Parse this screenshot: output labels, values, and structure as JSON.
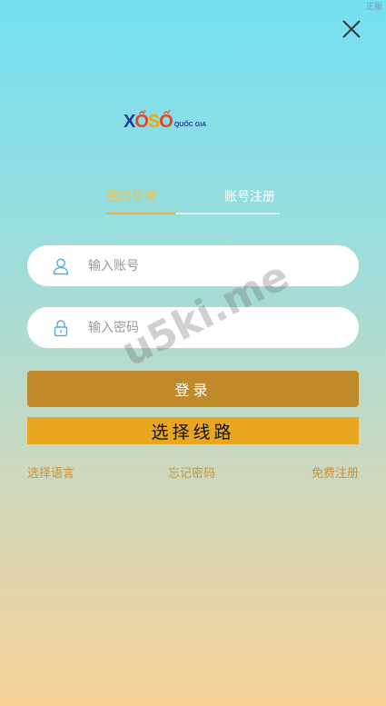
{
  "corner_tag": "正版",
  "logo": {
    "main": [
      "X",
      "Ổ",
      "S",
      "Ố"
    ],
    "sub": "QUỐC GIA"
  },
  "tabs": {
    "login": "密码登录",
    "register": "账号注册"
  },
  "form": {
    "account_placeholder": "输入账号",
    "password_placeholder": "输入密码",
    "account_icon": "user-icon",
    "password_icon": "lock-icon"
  },
  "buttons": {
    "login": "登录",
    "select_line": "选择线路"
  },
  "links": {
    "language": "选择语言",
    "forgot": "忘记密码",
    "free_register": "免费注册"
  },
  "watermark": "u5ki.me",
  "colors": {
    "accent_gold": "#c08a2a",
    "line_button": "#e8a621",
    "tab_active": "#e8c258",
    "icon_blue": "#5aa8d8"
  }
}
